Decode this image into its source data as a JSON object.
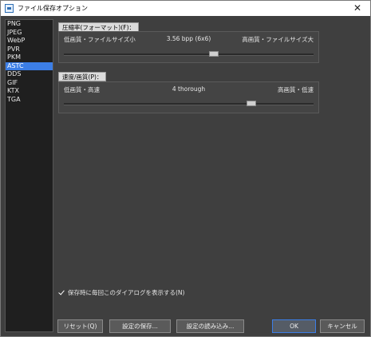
{
  "window": {
    "title": "ファイル保存オプション",
    "close_glyph": "✕"
  },
  "formats": {
    "items": [
      "PNG",
      "JPEG",
      "WebP",
      "PVR",
      "PKM",
      "ASTC",
      "DDS",
      "GIF",
      "KTX",
      "TGA"
    ],
    "selected": "ASTC"
  },
  "compression": {
    "section_label": "圧縮率(フォーマット)(F)：",
    "min_label": "低画質・ファイルサイズ小",
    "value_label": "3.56 bpp (6x6)",
    "max_label": "高画質・ファイルサイズ大",
    "level": 0.6
  },
  "speed": {
    "section_label": "速度/画質(P)：",
    "min_label": "低画質・高速",
    "value_label": "4 thorough",
    "max_label": "高画質・低速",
    "level": 0.75
  },
  "options": {
    "show_dialog_label": "保存時に毎回このダイアログを表示する(N)",
    "show_dialog_checked": true
  },
  "buttons": {
    "reset": "リセット(Q)",
    "save_settings": "設定の保存...",
    "load_settings": "設定の読み込み...",
    "ok": "OK",
    "cancel": "キャンセル"
  }
}
